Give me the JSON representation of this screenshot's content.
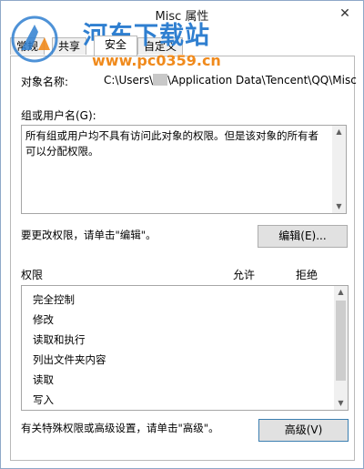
{
  "window": {
    "title": "Misc 属性",
    "close_glyph": "✕"
  },
  "watermark": {
    "site_name": "河东下载站",
    "url": "www.pc0359.cn"
  },
  "tabs": [
    {
      "label": "常规"
    },
    {
      "label": "共享"
    },
    {
      "label": "安全"
    },
    {
      "label": "自定义"
    }
  ],
  "object": {
    "label": "对象名称:",
    "path_prefix": "C:\\Users\\",
    "path_suffix": "\\Application Data\\Tencent\\QQ\\Misc"
  },
  "groups": {
    "label": "组或用户名(G):",
    "message": "所有组或用户均不具有访问此对象的权限。但是该对象的所有者可以分配权限。"
  },
  "change_permissions": {
    "hint": "要更改权限，请单击\"编辑\"。",
    "edit_button": "编辑(E)..."
  },
  "permissions": {
    "header": "权限",
    "allow": "允许",
    "deny": "拒绝",
    "items": [
      {
        "label": "完全控制"
      },
      {
        "label": "修改"
      },
      {
        "label": "读取和执行"
      },
      {
        "label": "列出文件夹内容"
      },
      {
        "label": "读取"
      },
      {
        "label": "写入"
      }
    ]
  },
  "advanced": {
    "hint": "有关特殊权限或高级设置，请单击\"高级\"。",
    "button": "高级(V)"
  },
  "colors": {
    "watermark_blue": "#2f7fd0",
    "watermark_orange": "#f08a1c",
    "active_tab_bg": "#ffffff",
    "button_bg": "#e1e1e1"
  }
}
